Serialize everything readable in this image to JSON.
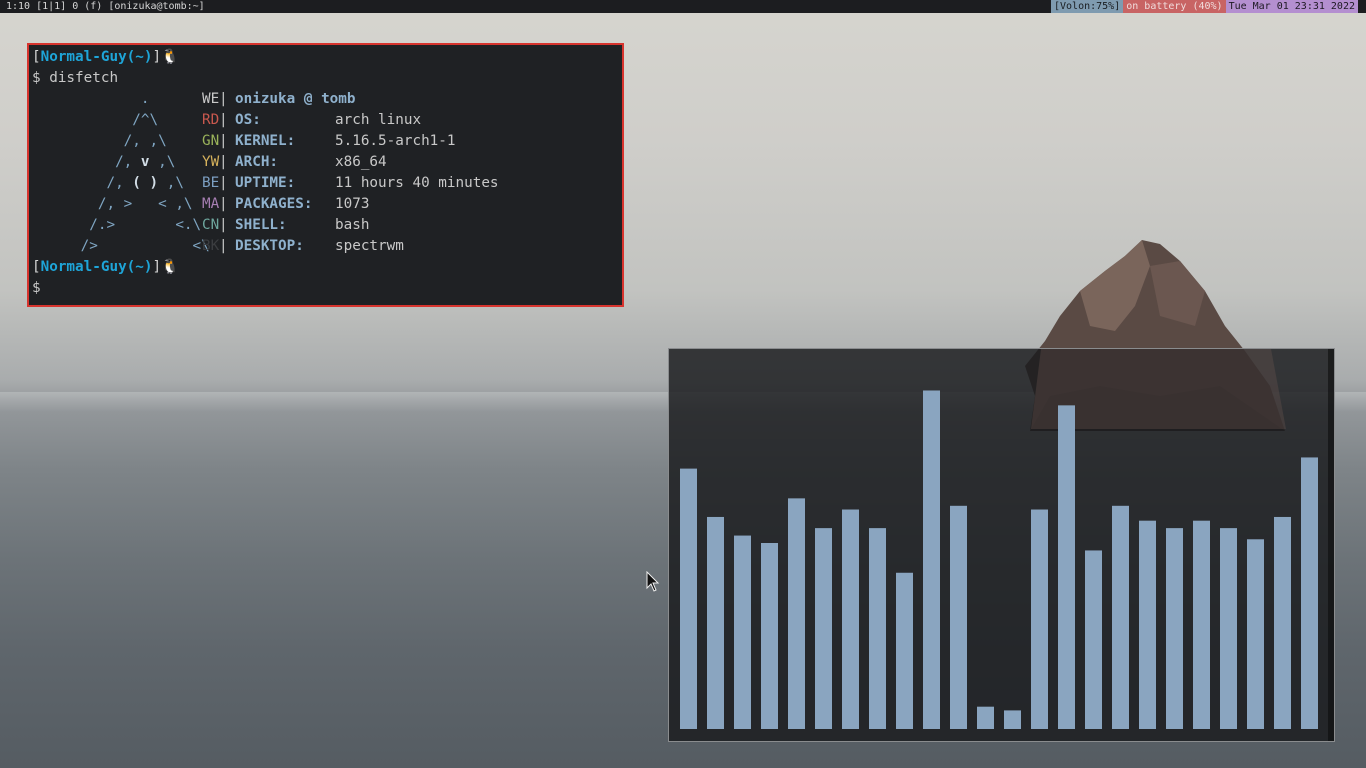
{
  "statusbar": {
    "left": "1:10 [1|1] 0 (f) [onizuka@tomb:~]",
    "volume": "[Volon:75%]",
    "battery": "on battery (40%)",
    "datetime": "Tue Mar 01 23:31 2022"
  },
  "terminal": {
    "prompt_open": "[",
    "prompt_name": "Normal-Guy(~)",
    "prompt_close": "]",
    "prompt_icon": "tux-penguin-icon",
    "command_line": "$ disfetch",
    "user_host": "onizuka @ tomb",
    "logo": [
      "             .",
      "            /^\\",
      "           /, ,\\",
      "          /, v ,\\",
      "         /, ( ) ,\\",
      "        /, >   < ,\\",
      "       /.>       <.\\",
      "      />           <\\"
    ],
    "codes": [
      {
        "text": "WE",
        "color": "#c8c8c8"
      },
      {
        "text": "RD",
        "color": "#c8584e"
      },
      {
        "text": "GN",
        "color": "#9ab35a"
      },
      {
        "text": "YW",
        "color": "#d6b25c"
      },
      {
        "text": "BE",
        "color": "#7c9fc2"
      },
      {
        "text": "MA",
        "color": "#a77fb3"
      },
      {
        "text": "CN",
        "color": "#6ea79e"
      },
      {
        "text": "BK",
        "color": "#3b3d40"
      }
    ],
    "info": [
      {
        "key": "OS:",
        "value": "arch linux"
      },
      {
        "key": "KERNEL:",
        "value": "5.16.5-arch1-1"
      },
      {
        "key": "ARCH:",
        "value": "x86_64"
      },
      {
        "key": "UPTIME:",
        "value": "11 hours 40 minutes"
      },
      {
        "key": "PACKAGES:",
        "value": "1073"
      },
      {
        "key": "SHELL:",
        "value": "bash"
      },
      {
        "key": "DESKTOP:",
        "value": "spectrwm"
      }
    ],
    "final_prompt": "$"
  },
  "visualizer": {
    "bar_color": "#8aa5c0",
    "levels": [
      0.7,
      0.57,
      0.52,
      0.5,
      0.62,
      0.54,
      0.59,
      0.54,
      0.42,
      0.91,
      0.6,
      0.06,
      0.05,
      0.59,
      0.87,
      0.48,
      0.6,
      0.56,
      0.54,
      0.56,
      0.54,
      0.51,
      0.57,
      0.73
    ]
  }
}
